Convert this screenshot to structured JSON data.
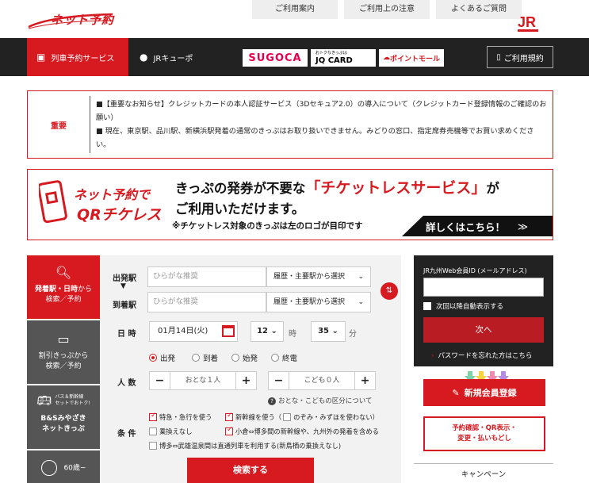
{
  "header": {
    "logo_text": "ネット予約",
    "top_links": [
      "ご利用案内",
      "ご利用上の注意",
      "よくあるご質問"
    ],
    "jr_text": "JR"
  },
  "nav": {
    "tab_train": "列車予約サービス",
    "tab_cue": "JRキューポ",
    "sugoca": "SUGOCA",
    "jq_small": "おトクなきっぷは",
    "jq_card": "JQ CARD",
    "point_mall": "ポイントモール",
    "terms": "ご利用規約"
  },
  "notice": {
    "label": "重要",
    "line1": "■【重要なお知らせ】クレジットカードの本人認証サービス（3Dセキュア2.0）の導入について（クレジットカード登録情報のご確認のお願い）",
    "line2": "■ 現在、東京駅、品川駅、新横浜駅発着の通常のきっぷはお取り扱いできません。みどりの窓口、指定席券売機等でお買い求めください。"
  },
  "qr_banner": {
    "logo_line1": "ネット予約で",
    "logo_line2": "QRチケレス",
    "head1_pre": "きっぷの発券が不要な",
    "head1_red": "「チケットレスサービス」",
    "head1_post": "が",
    "head2": "ご利用いただけます。",
    "sub": "※チケットレス対象のきっぷは左のロゴが目印です",
    "detail": "詳しくはこちら！",
    "detail_arrow": "≫"
  },
  "left_tabs": {
    "tab1_line1": "発着駅・日時",
    "tab1_from": "から",
    "tab1_line2": "検索／予約",
    "tab2_line1": "割引きっぷから",
    "tab2_line2": "検索／予約",
    "tab3_small1": "バス＆新幹線",
    "tab3_small2": "セットでおトク!",
    "tab3_line1": "B&Sみやざき",
    "tab3_line2": "ネットきっぷ",
    "tab4": "60歳~"
  },
  "form": {
    "depart_label": "出発駅",
    "arrive_label": "到着駅",
    "station_placeholder": "ひらがな推奨",
    "history_select": "履歴・主要駅から選択",
    "date_label": "日 時",
    "date_value": "01月14日(火)",
    "hour_value": "12",
    "hour_unit": "時",
    "minute_value": "35",
    "minute_unit": "分",
    "radios": [
      "出発",
      "到着",
      "始発",
      "終電"
    ],
    "people_label": "人 数",
    "adult_value": "おとな１人",
    "child_value": "こども０人",
    "help_text": "おとな・こどもの区分について",
    "cond_label": "条 件",
    "cond1": "特急・急行を使う",
    "cond2": "新幹線を使う（",
    "cond2b": "のぞみ・みずほを使わない）",
    "cond3": "乗換えなし",
    "cond4": "小倉⇔博多間の新幹線や、九州外の発着を含める",
    "cond5": "博多⇔武雄温泉間は直通列車を利用する(新鳥栖の乗換えなし)",
    "search_button": "検索する"
  },
  "right_panel": {
    "id_label": "JR九州Web会員ID (メールアドレス)",
    "auto_display": "次回以降自動表示する",
    "next_button": "次へ",
    "forgot": "パスワードを忘れた方はこちら",
    "register": "新規会員登録",
    "confirm_line1": "予約確認・QR表示・",
    "confirm_line2": "変更・払いもどし",
    "campaign": "キャンペーン"
  },
  "colors": {
    "accent": "#d71920",
    "dark": "#222222",
    "gray_tab": "#555555",
    "form_bg": "#f2f2f2"
  }
}
